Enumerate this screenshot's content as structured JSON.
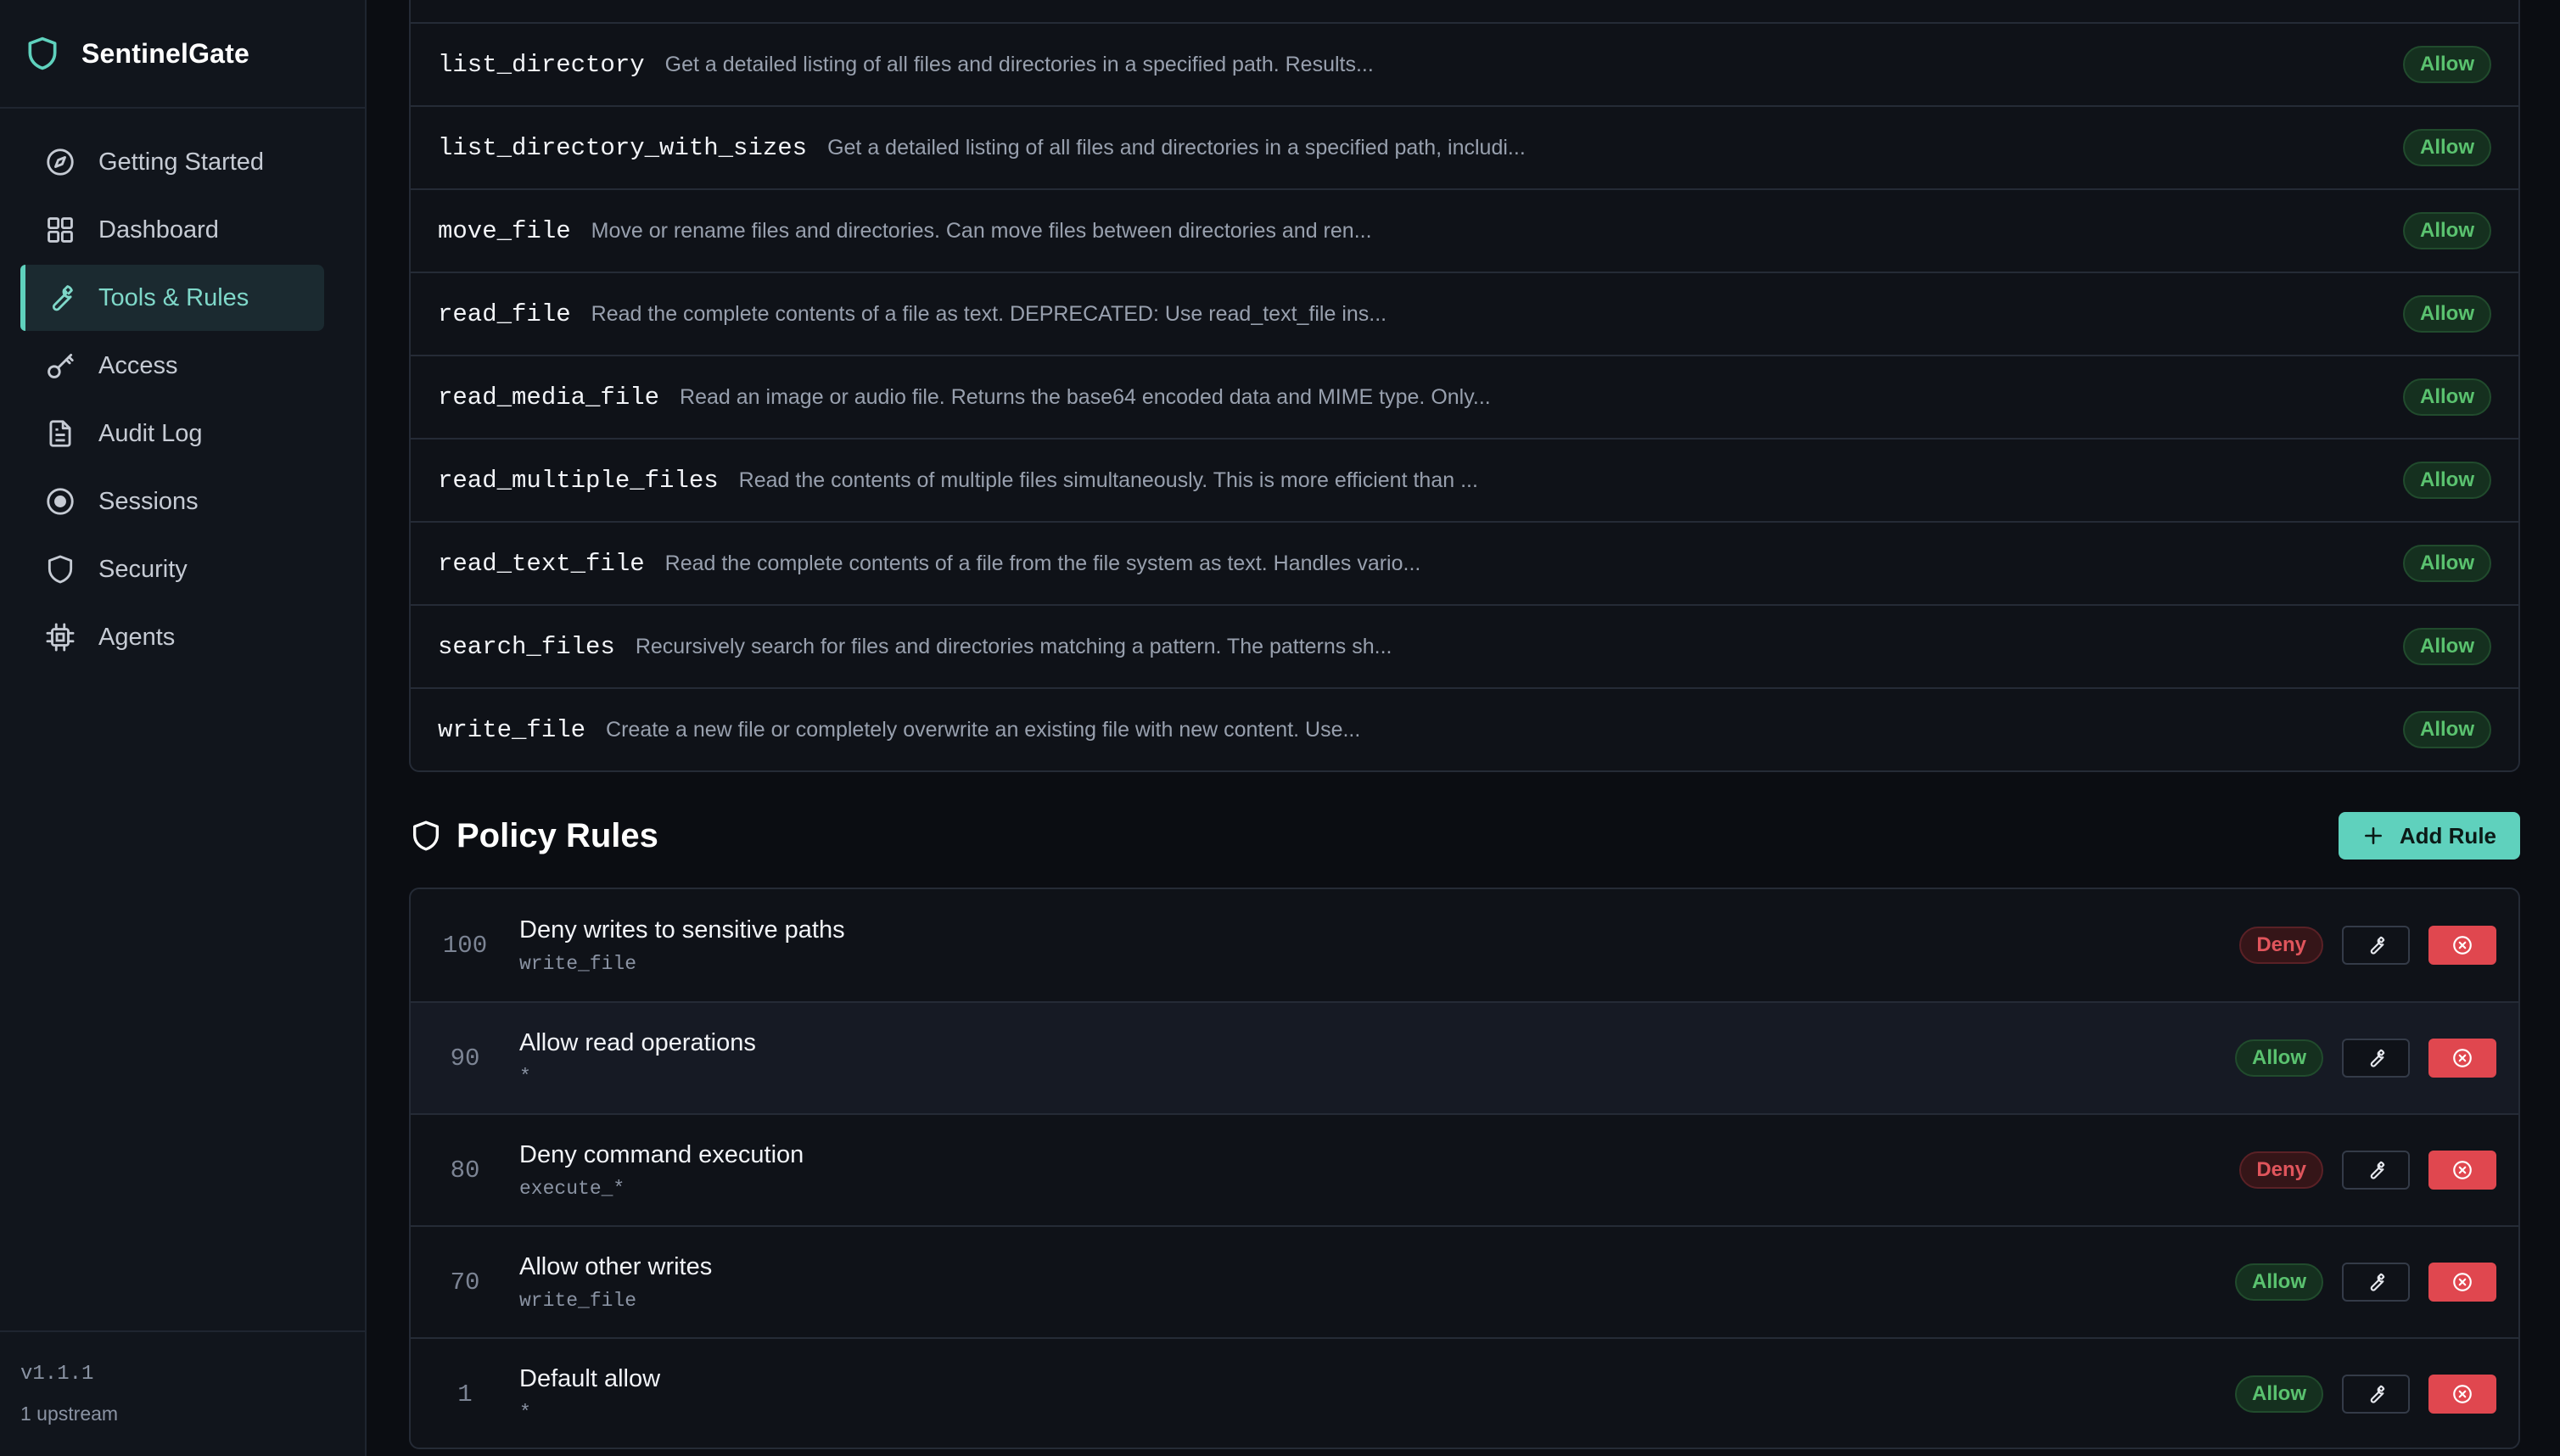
{
  "app": {
    "name": "SentinelGate",
    "version": "v1.1.1",
    "upstream": "1 upstream"
  },
  "sidebar": {
    "items": [
      {
        "label": "Getting Started",
        "icon": "compass-icon"
      },
      {
        "label": "Dashboard",
        "icon": "grid-icon"
      },
      {
        "label": "Tools & Rules",
        "icon": "wrench-icon",
        "active": true
      },
      {
        "label": "Access",
        "icon": "key-icon"
      },
      {
        "label": "Audit Log",
        "icon": "document-icon"
      },
      {
        "label": "Sessions",
        "icon": "target-icon"
      },
      {
        "label": "Security",
        "icon": "shield-icon"
      },
      {
        "label": "Agents",
        "icon": "chip-icon"
      }
    ]
  },
  "tools": [
    {
      "name": "list_directory",
      "desc": "Get a detailed listing of all files and directories in a specified path. Results...",
      "badge": "Allow"
    },
    {
      "name": "list_directory_with_sizes",
      "desc": "Get a detailed listing of all files and directories in a specified path, includi...",
      "badge": "Allow"
    },
    {
      "name": "move_file",
      "desc": "Move or rename files and directories. Can move files between directories and ren...",
      "badge": "Allow"
    },
    {
      "name": "read_file",
      "desc": "Read the complete contents of a file as text. DEPRECATED: Use read_text_file ins...",
      "badge": "Allow"
    },
    {
      "name": "read_media_file",
      "desc": "Read an image or audio file. Returns the base64 encoded data and MIME type. Only...",
      "badge": "Allow"
    },
    {
      "name": "read_multiple_files",
      "desc": "Read the contents of multiple files simultaneously. This is more efficient than ...",
      "badge": "Allow"
    },
    {
      "name": "read_text_file",
      "desc": "Read the complete contents of a file from the file system as text. Handles vario...",
      "badge": "Allow"
    },
    {
      "name": "search_files",
      "desc": "Recursively search for files and directories matching a pattern. The patterns sh...",
      "badge": "Allow"
    },
    {
      "name": "write_file",
      "desc": "Create a new file or completely overwrite an existing file with new content. Use...",
      "badge": "Allow"
    }
  ],
  "policy": {
    "title": "Policy Rules",
    "add_label": "Add Rule",
    "rules": [
      {
        "priority": "100",
        "name": "Deny writes to sensitive paths",
        "pattern": "write_file",
        "action": "Deny"
      },
      {
        "priority": "90",
        "name": "Allow read operations",
        "pattern": "*",
        "action": "Allow"
      },
      {
        "priority": "80",
        "name": "Deny command execution",
        "pattern": "execute_*",
        "action": "Deny"
      },
      {
        "priority": "70",
        "name": "Allow other writes",
        "pattern": "write_file",
        "action": "Allow"
      },
      {
        "priority": "1",
        "name": "Default allow",
        "pattern": "*",
        "action": "Allow"
      }
    ]
  },
  "colors": {
    "accent": "#5fd1bd",
    "allow": "#5ac26f",
    "deny": "#e0555c",
    "delete": "#e0474f"
  }
}
